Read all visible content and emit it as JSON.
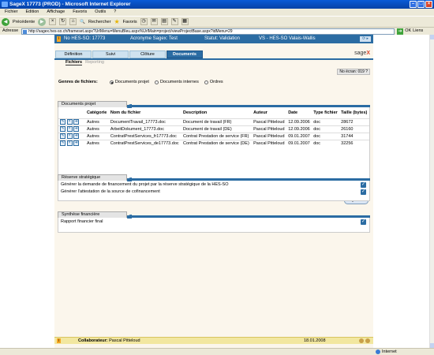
{
  "window": {
    "title": "SageX 17773 (PROD) - Microsoft Internet Explorer"
  },
  "menu": [
    "Fichier",
    "Edition",
    "Affichage",
    "Favoris",
    "Outils",
    "?"
  ],
  "toolbar": {
    "back_label": "Précédente",
    "search_label": "Rechercher",
    "favorites_label": "Favoris"
  },
  "address": {
    "label": "Adresse",
    "url": "http://sagex.hes-so.ch/frameset.aspx?UrlMenu=MenuBleu.aspx%UrlMain=project/viewProjectBase.aspx?idMenu=29",
    "go_label": "OK",
    "links_label": "Liens"
  },
  "app": {
    "header": {
      "no": "No HES-SO: 17773",
      "acronyme": "Acronyme Sagex: Test",
      "statut": "Statut: Validation",
      "vs": "VS - HES-SO Valais-Wallis"
    },
    "tabs": [
      "Définition",
      "Suivi",
      "Clôture",
      "Documents"
    ],
    "active_tab": "Documents",
    "logo": {
      "text": "sage",
      "x": "X"
    },
    "subtabs": {
      "active": "Fichiers",
      "inactive": "Reporting"
    },
    "no_ecran": "No écran: 019",
    "genres": {
      "label": "Genres de fichiers:",
      "options": [
        "Documents projet",
        "Documents internes",
        "Ordres"
      ],
      "selected": "Documents projet"
    },
    "documents_panel": {
      "title": "Documents projet",
      "columns": [
        "Catégorie",
        "Nom du fichier",
        "Description",
        "Auteur",
        "Date",
        "Type fichier",
        "Taille (bytes)"
      ],
      "rows": [
        {
          "categorie": "Autres",
          "nom": "DocumentTravail_17773.doc",
          "description": "Document de travail (FR)",
          "auteur": "Pascal Pitteloud",
          "date": "12.09.2006",
          "type": "doc",
          "taille": "28672"
        },
        {
          "categorie": "Autres",
          "nom": "ArbeitDokument_17773.doc",
          "description": "Document de travail (DE)",
          "auteur": "Pascal Pitteloud",
          "date": "12.09.2006",
          "type": "doc",
          "taille": "26160"
        },
        {
          "categorie": "Autres",
          "nom": "ContratPrestServices_fr17773.doc",
          "description": "Contrat Prestation de service (FR)",
          "auteur": "Pascal Pitteloud",
          "date": "09.01.2007",
          "type": "doc",
          "taille": "31744"
        },
        {
          "categorie": "Autres",
          "nom": "ContratPrestServices_de17773.doc",
          "description": "Contrat Prestation de service (DE)",
          "auteur": "Pascal Pitteloud",
          "date": "09.01.2007",
          "type": "doc",
          "taille": "32256"
        }
      ],
      "add_label": "Ajouter"
    },
    "reserve_panel": {
      "title": "Réserve stratégique",
      "items": [
        "Générer la demande de financement du projet par la réserve stratégique de la HES-SO",
        "Générer l'attestation de la source de cofinancement"
      ]
    },
    "synthese_panel": {
      "title": "Synthèse financière",
      "items": [
        "Rapport financier final"
      ]
    },
    "footer": {
      "collab_label": "Collaborateur:",
      "collab_name": "Pascal Pitteloud",
      "date": "18.01.2008"
    }
  },
  "statusbar": {
    "zone": "Internet"
  },
  "colors": {
    "accent": "#2b6ca3",
    "footer": "#f2e7a0",
    "titlebar": "#0a5bd8"
  }
}
